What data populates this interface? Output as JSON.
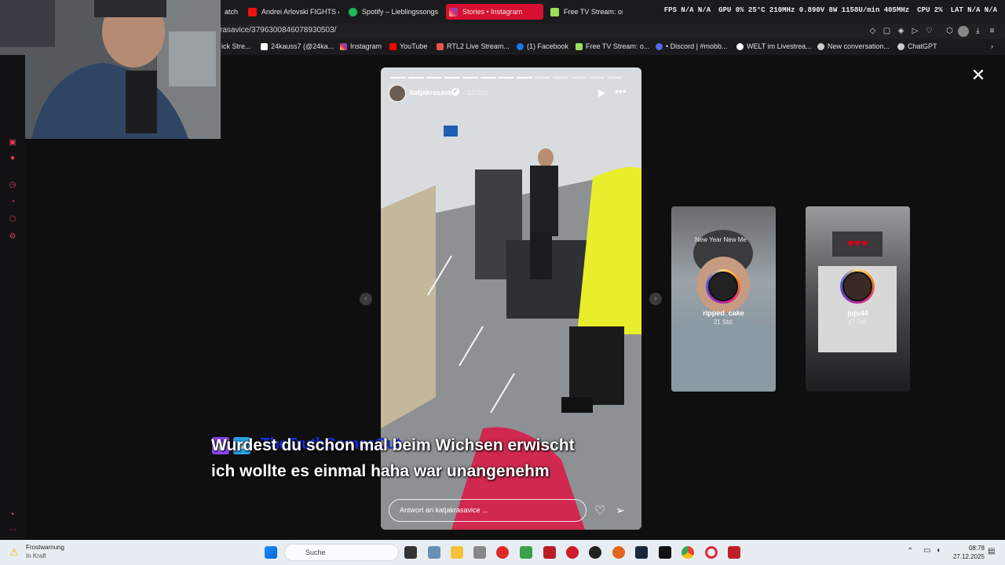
{
  "browser": {
    "tabs": [
      {
        "label": "atch",
        "active": false
      },
      {
        "label": "Andrei Arlovski FIGHTS 4",
        "active": false
      },
      {
        "label": "Spotify – Lieblingssongs",
        "active": false
      },
      {
        "label": "Stories • Instagram",
        "active": true
      },
      {
        "label": "Free TV Stream: online",
        "active": false
      }
    ],
    "url": "rasavice/3796300846078930503/",
    "bookmarks": [
      {
        "label": "ick Stre..."
      },
      {
        "label": "24kauss7 (@24ka..."
      },
      {
        "label": "Instagram"
      },
      {
        "label": "YouTube"
      },
      {
        "label": "RTL2 Live Stream..."
      },
      {
        "label": "(1) Facebook"
      },
      {
        "label": "Free TV Stream: o..."
      },
      {
        "label": "• Discord | #mobb..."
      },
      {
        "label": "WELT im Livestrea..."
      },
      {
        "label": "New conversation..."
      },
      {
        "label": "ChatGPT"
      }
    ]
  },
  "hardware": {
    "fps": "FPS N/A N/A",
    "gpu": "GPU 0% 25°C 210MHz 0.890V 8W 1158U/min 405MHz",
    "cpu": "CPU 2%",
    "lat": "LAT N/A N/A"
  },
  "story": {
    "username": "katjakrasavice",
    "time": "12 Std.",
    "reply_placeholder": "Antwort an katjakrasavice ..."
  },
  "previews": [
    {
      "username": "ripped_cake",
      "time": "21 Std.",
      "caption": "New Year New Me"
    },
    {
      "username": "juju44",
      "time": "17 Std."
    }
  ],
  "chat": {
    "name": "TheTruthComesOut",
    "line1": "Wurdest du schon mal beim Wichsen erwischt",
    "line2": "ich wollte es einmal haha war unangenehm"
  },
  "taskbar": {
    "weather_title": "Frostwarnung",
    "weather_sub": "In Kraft",
    "search_label": "Suche",
    "time": "08:78",
    "date": "27.12.2025"
  },
  "colors": {
    "active_tab": "#d8102f",
    "chat_name": "#1a2fe0"
  }
}
